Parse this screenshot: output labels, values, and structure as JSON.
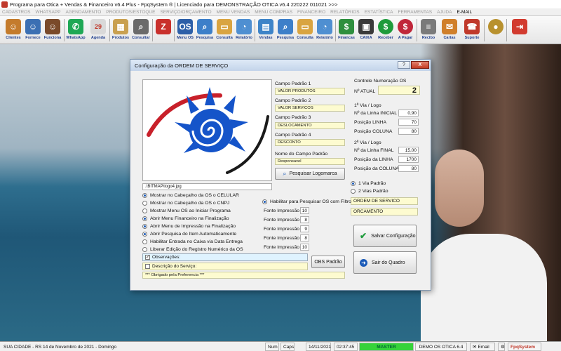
{
  "window": {
    "title": "Programa para Otica + Vendas & Financeiro v6.4 Plus - FpqSystem ® | Licenciado para  DEMONSTRAÇÃO OTICA v6.4 220222 011021 >>>"
  },
  "menu": [
    "CADASTROS",
    "WHATSAPP",
    "AGENDAMENTO",
    "PRODUTOS/ESTOQUE",
    "SERVIÇO/ORÇAMENTO",
    "MENU VENDAS",
    "MENU COMPRAS",
    "FINANCEIRO",
    "RELATÓRIOS",
    "ESTATÍSTICA",
    "FERRAMENTAS",
    "AJUDA",
    "E-MAIL"
  ],
  "toolbar": [
    {
      "label": "Clientes",
      "icon": "people-icon",
      "color": "#c47b2c"
    },
    {
      "label": "Fornece",
      "icon": "supplier-icon",
      "color": "#3b6fb3"
    },
    {
      "label": "Funciona",
      "icon": "employee-icon",
      "color": "#7a4a2a"
    },
    {
      "label": "WhatsApp",
      "icon": "whatsapp-icon",
      "color": "#1fa855"
    },
    {
      "label": "Agenda",
      "icon": "calendar-icon",
      "color": "#d9d9d9"
    },
    {
      "label": "Produtos",
      "icon": "boxes-icon",
      "color": "#c9a050"
    },
    {
      "label": "Consultar",
      "icon": "magnifier-icon",
      "color": "#6a6a6a"
    },
    {
      "label": "",
      "icon": "transfer-icon",
      "color": "#c9302c"
    },
    {
      "label": "Menu OS",
      "icon": "os-icon",
      "color": "#2d5fa8"
    },
    {
      "label": "Pesquisa",
      "icon": "search-doc-icon",
      "color": "#3d7fc9"
    },
    {
      "label": "Consulta",
      "icon": "folder-icon",
      "color": "#d9a441"
    },
    {
      "label": "Relatório",
      "icon": "report-icon",
      "color": "#4f8fd1"
    },
    {
      "label": "Vendas",
      "icon": "sales-icon",
      "color": "#3e84c8"
    },
    {
      "label": "Pesquisa",
      "icon": "search-doc-icon",
      "color": "#3d7fc9"
    },
    {
      "label": "Consulta",
      "icon": "folder-icon",
      "color": "#d9a441"
    },
    {
      "label": "Relatório",
      "icon": "report-icon",
      "color": "#4f8fd1"
    },
    {
      "label": "Financas",
      "icon": "finance-icon",
      "color": "#2f8f3e"
    },
    {
      "label": "CAIXA",
      "icon": "cash-register-icon",
      "color": "#3a3a3a"
    },
    {
      "label": "Receber",
      "icon": "receive-money-icon",
      "color": "#1e9b3b"
    },
    {
      "label": "A Pagar",
      "icon": "pay-money-icon",
      "color": "#c0273a"
    },
    {
      "label": "Recibo",
      "icon": "receipt-icon",
      "color": "#7a7a7a"
    },
    {
      "label": "Cartas",
      "icon": "letter-icon",
      "color": "#d07f2a"
    },
    {
      "label": "Suporte",
      "icon": "support-icon",
      "color": "#c0392b"
    },
    {
      "label": "",
      "icon": "coin-icon",
      "color": "#b8912e"
    },
    {
      "label": "",
      "icon": "exit-icon",
      "color": "#d23b2f"
    }
  ],
  "dialog": {
    "title": "Configuração da ORDEM DE SERVIÇO",
    "help_label": "?",
    "close_label": "X",
    "logo_path": ".\\BITMAP\\logo4.jpg",
    "campo_padrao": [
      {
        "label": "Campo Padrão 1",
        "value": "VALOR PRODUTOS"
      },
      {
        "label": "Campo Padrão 2",
        "value": "VALOR SERVICOS"
      },
      {
        "label": "Campo Padrão 3",
        "value": "DESLOCAMENTO"
      },
      {
        "label": "Campo Padrão 4",
        "value": "DESCONTO"
      }
    ],
    "nome_campo_label": "Nome do Campo Padrão",
    "nome_campo_value": "Responsavel",
    "pesquisar_logo_label": "Pesquisar Logomarca",
    "controle_label": "Controle Numeração OS",
    "n_atual_label": "Nº ATUAL",
    "n_atual_value": "2",
    "via1_title": "1ª Via / Logo",
    "via1_fields": [
      {
        "label": "Nº da Linha INICIAL",
        "value": "0,90"
      },
      {
        "label": "Posição LINHA",
        "value": "70"
      },
      {
        "label": "Posição COLUNA",
        "value": "80"
      }
    ],
    "via2_title": "2ª Via / Logo",
    "via2_fields": [
      {
        "label": "Nº da Linha FINAL",
        "value": "15,00"
      },
      {
        "label": "Posição da LINHA",
        "value": "1700"
      },
      {
        "label": "Posição da COLUNA",
        "value": "80"
      }
    ],
    "via_options": [
      {
        "label": "1 Via Padrão",
        "selected": true
      },
      {
        "label": "2 Vias Padrão",
        "selected": false
      }
    ],
    "title_fields": [
      "ORDEM DE SERVICO",
      "ORCAMENTO"
    ],
    "options": [
      {
        "label": "Mostrar no Cabeçalho da OS o CELULAR",
        "selected": true
      },
      {
        "label": "Mostrar no Cabeçalho da OS o CNPJ",
        "selected": false
      },
      {
        "label": "Mostrar Menu OS ao Iniciar Programa",
        "selected": false
      },
      {
        "label": "Abrir Menu Financeiro na Finalização",
        "selected": true
      },
      {
        "label": "Abrir Menu de Impressão na Finalização",
        "selected": true
      },
      {
        "label": "Abrir Pesquisa do Item Automaticamente",
        "selected": true
      },
      {
        "label": "Habilitar Entrada no Caixa via Data Entrega",
        "selected": false
      },
      {
        "label": "Liberar Edição do Registro Numérico da OS",
        "selected": false
      }
    ],
    "habilitar_pesquisa_label": "Habilitar para Pesquisar OS com Filtro",
    "fontes": [
      {
        "label": "Fonte Impressão 1",
        "value": "10"
      },
      {
        "label": "Fonte Impressão 2",
        "value": "8"
      },
      {
        "label": "Fonte Impressão 3",
        "value": "9"
      },
      {
        "label": "Fonte Impressão 4",
        "value": "8"
      },
      {
        "label": "Fonte Impressão 5",
        "value": "10"
      }
    ],
    "observacoes_label": "Observações:",
    "descricao_label": "Descrição do Serviço:",
    "obs_padrao_label": "OBS Padrão",
    "footer_text": "*** Obrigado pela Preferencia ***",
    "salvar_label": "Salvar Configuração",
    "sair_label": "Sair do Quadro"
  },
  "statusbar": {
    "location": "SUA CIDADE - RS 14 de Novembro de 2021 - Domingo",
    "num": "Num",
    "caps": "Caps",
    "date": "14/11/2021",
    "time": "02:37:45",
    "master": "MASTER",
    "version": "DEMO OS OTICA 6.4",
    "email": "Email",
    "brand": "FpqSystem"
  },
  "colors": {
    "accent": "#1b5bb8",
    "input_yellow": "#fdfbd0",
    "master_green": "#36d33a",
    "brand_red": "#c0392b"
  }
}
